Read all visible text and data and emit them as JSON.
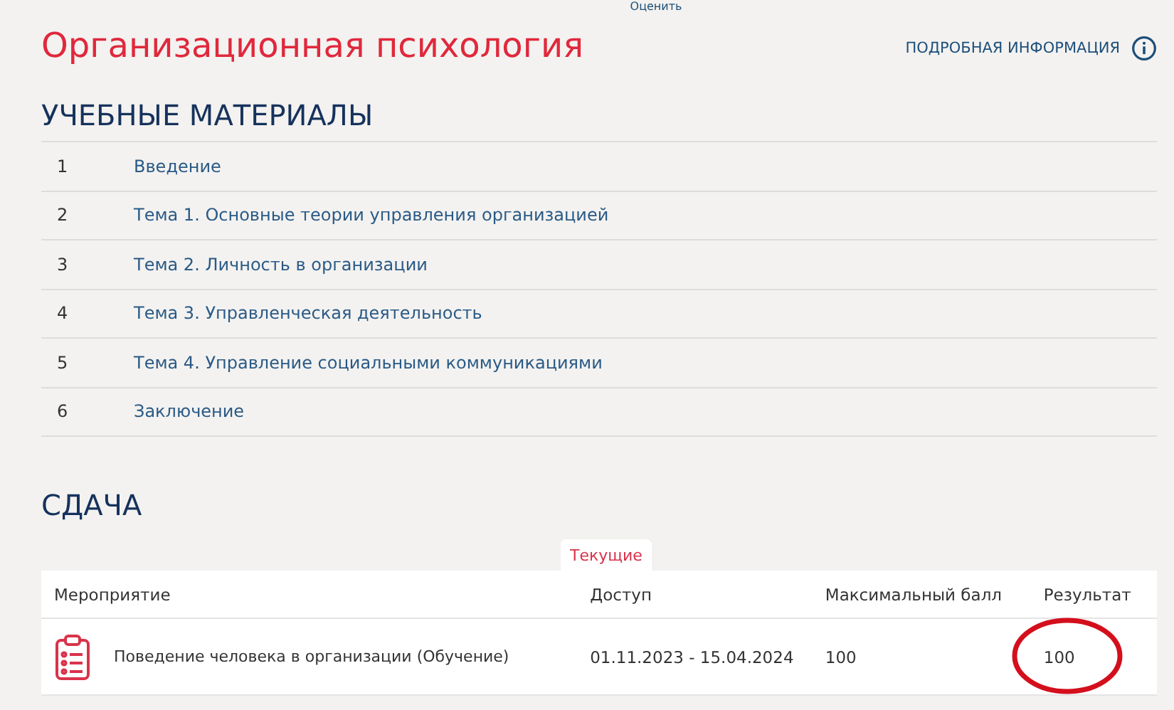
{
  "top_link": "Оценить",
  "title": "Организационная психология",
  "info_link": "ПОДРОБНАЯ ИНФОРМАЦИЯ",
  "materials": {
    "heading": "УЧЕБНЫЕ МАТЕРИАЛЫ",
    "items": [
      {
        "number": "1",
        "label": "Введение"
      },
      {
        "number": "2",
        "label": "Тема 1. Основные теории управления организацией"
      },
      {
        "number": "3",
        "label": "Тема 2. Личность в организации"
      },
      {
        "number": "4",
        "label": "Тема 3. Управленческая деятельность"
      },
      {
        "number": "5",
        "label": "Тема 4. Управление социальными коммуникациями"
      },
      {
        "number": "6",
        "label": "Заключение"
      }
    ]
  },
  "submission": {
    "heading": "СДАЧА",
    "tabs": [
      {
        "label": "Текущие",
        "selected": true
      }
    ],
    "columns": [
      "Мероприятие",
      "Доступ",
      "Максимальный балл",
      "Результат"
    ],
    "rows": [
      {
        "event": "Поведение человека в организации (Обучение)",
        "access": "01.11.2023 - 15.04.2024",
        "max_score": "100",
        "result": "100",
        "circled": true
      }
    ]
  }
}
